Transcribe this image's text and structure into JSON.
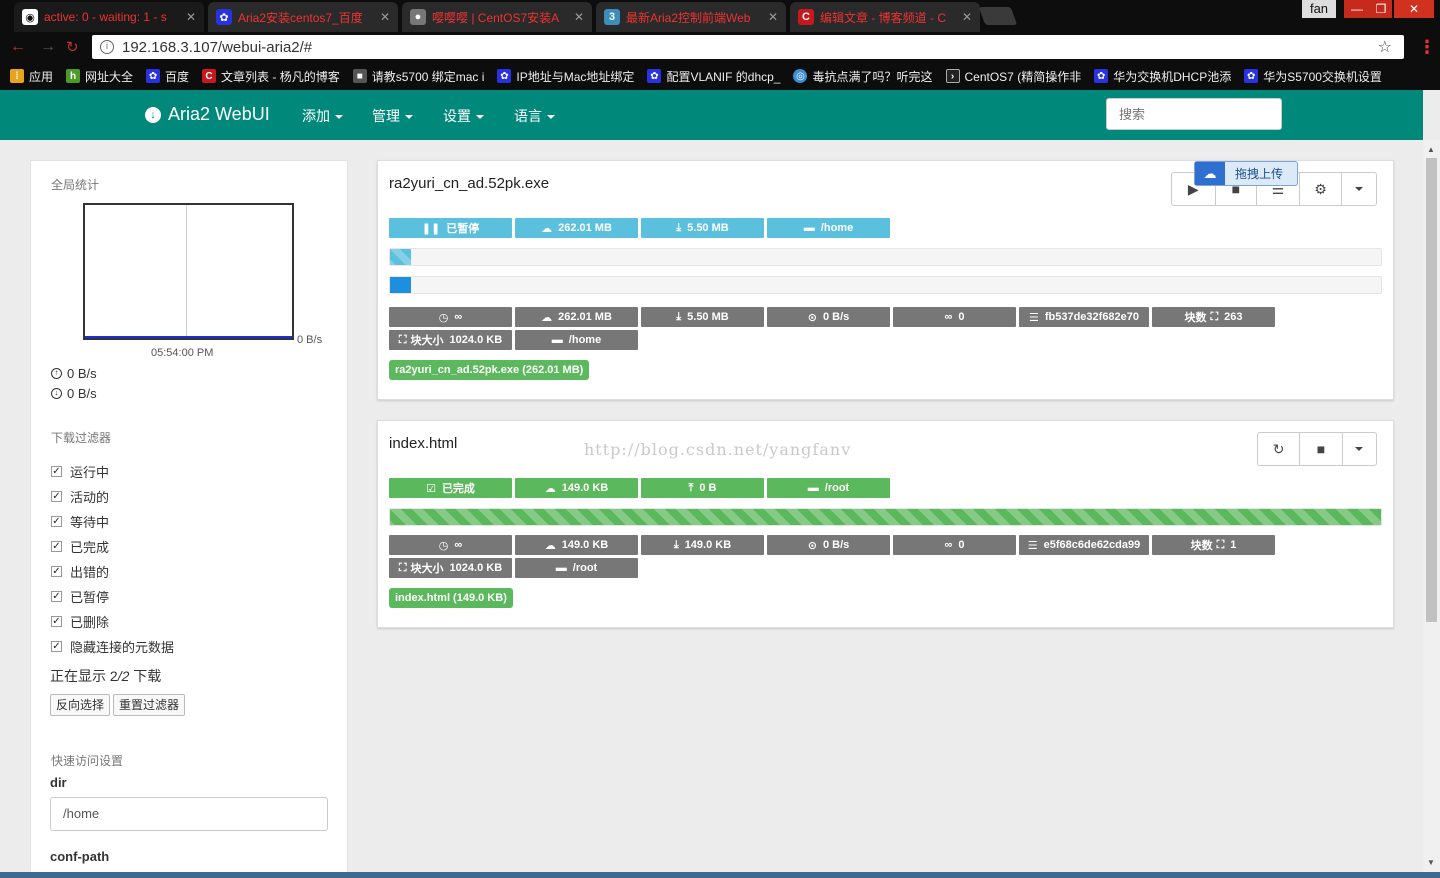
{
  "browser": {
    "tabs": [
      {
        "title": "active: 0 - waiting: 1 - s",
        "icon": "aria2-icon",
        "color": "#cc1818"
      },
      {
        "title": "Aria2安装centos7_百度",
        "icon": "baidu-paw-icon",
        "color": "#2932e1"
      },
      {
        "title": "嘤嘤嘤 | CentOS7安装A",
        "icon": "alien-icon",
        "color": "#999999"
      },
      {
        "title": "最新Aria2控制前端Web",
        "icon": "page-icon",
        "color": "#3c8dbc"
      },
      {
        "title": "编辑文章 - 博客频道 - C",
        "icon": "csdn-icon",
        "color": "#c9171e"
      }
    ],
    "user_label": "fan",
    "window_buttons": {
      "minimize": "—",
      "restore": "❐",
      "close": "✕"
    },
    "url": "192.168.3.107/webui-aria2/#",
    "bookmarks": [
      {
        "label": "应用",
        "icon": "apps-icon"
      },
      {
        "label": "网址大全",
        "icon": "hao123-icon"
      },
      {
        "label": "百度",
        "icon": "baidu-paw-icon"
      },
      {
        "label": "文章列表 - 杨凡的博客",
        "icon": "csdn-icon"
      },
      {
        "label": "请教s5700 绑定mac i",
        "icon": "page-icon"
      },
      {
        "label": "IP地址与Mac地址绑定",
        "icon": "baidu-paw-icon"
      },
      {
        "label": "配置VLANIF 的dhcp_",
        "icon": "baidu-paw-icon"
      },
      {
        "label": "毒抗点满了吗？听完这",
        "icon": "chrome-icon"
      },
      {
        "label": "CentOS7 (精简操作非",
        "icon": "terminal-icon"
      },
      {
        "label": "华为交换机DHCP池添",
        "icon": "baidu-paw-icon"
      },
      {
        "label": "华为S5700交换机设置",
        "icon": "baidu-paw-icon"
      }
    ]
  },
  "navbar": {
    "brand": "Aria2 WebUI",
    "menus": [
      "添加",
      "管理",
      "设置",
      "语言"
    ],
    "search_placeholder": "搜索",
    "color": "#00897b"
  },
  "sidebar": {
    "global_stats_title": "全局统计",
    "graph_time": "05:54:00 PM",
    "graph_axis_label": "0 B/s",
    "upload_speed": "0 B/s",
    "download_speed": "0 B/s",
    "filter_title": "下载过滤器",
    "filters": [
      {
        "label": "运行中",
        "checked": true
      },
      {
        "label": "活动的",
        "checked": true
      },
      {
        "label": "等待中",
        "checked": true
      },
      {
        "label": "已完成",
        "checked": true
      },
      {
        "label": "出错的",
        "checked": true
      },
      {
        "label": "已暂停",
        "checked": true
      },
      {
        "label": "已删除",
        "checked": true
      },
      {
        "label": "隐藏连接的元数据",
        "checked": true
      }
    ],
    "showing_prefix": "正在显示",
    "showing_count": "2",
    "showing_sep": "/",
    "showing_total": "2",
    "showing_suffix": "下载",
    "invert_button": "反向选择",
    "reset_button": "重置过滤器",
    "quick_settings_title": "快速访问设置",
    "dir_label": "dir",
    "dir_value": "/home",
    "conf_path_label": "conf-path"
  },
  "downloads": [
    {
      "name": "ra2yuri_cn_ad.52pk.exe",
      "status": "已暂停",
      "size": "262.01 MB",
      "downloaded": "5.50 MB",
      "dir": "/home",
      "progress": 0.021,
      "eta": "∞",
      "total": "262.01 MB",
      "done": "5.50 MB",
      "speed": "0 B/s",
      "connections": "0",
      "gid": "fb537de32f682e70",
      "pieces_label": "块数",
      "pieces": "263",
      "piece_size_label": "块大小",
      "piece_size": "1024.0 KB",
      "file": "ra2yuri_cn_ad.52pk.exe (262.01 MB)"
    },
    {
      "name": "index.html",
      "status": "已完成",
      "size": "149.0 KB",
      "uploaded": "0 B",
      "dir": "/root",
      "progress": 1.0,
      "eta": "∞",
      "total": "149.0 KB",
      "done": "149.0 KB",
      "speed": "0 B/s",
      "connections": "0",
      "gid": "e5f68c6de62cda99",
      "pieces_label": "块数",
      "pieces": "1",
      "piece_size_label": "块大小",
      "piece_size": "1024.0 KB",
      "file": "index.html (149.0 KB)"
    }
  ],
  "upload_widget": {
    "label": "拖拽上传"
  },
  "watermark": "http://blog.csdn.net/yangfanv"
}
